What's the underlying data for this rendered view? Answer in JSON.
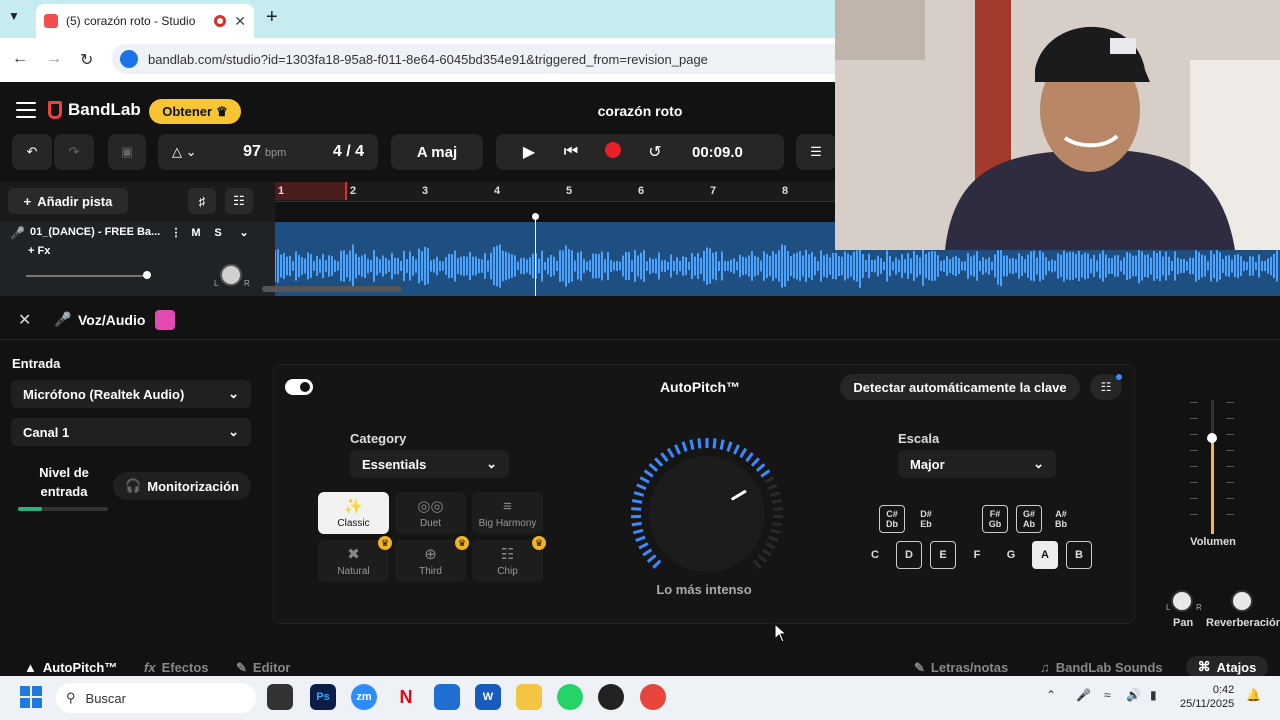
{
  "browser": {
    "tab_title": "(5) corazón roto - Studio",
    "url": "bandlab.com/studio?id=1303fa18-95a8-f011-8e64-6045bd354e91&triggered_from=revision_page"
  },
  "header": {
    "brand": "BandLab",
    "obtener_label": "Obtener",
    "song_title": "corazón roto"
  },
  "toolbar": {
    "bpm": "97",
    "bpm_unit": "bpm",
    "time_signature": "4 / 4",
    "key": "A maj",
    "time": "00:09.0"
  },
  "tracks": {
    "add_track_label": "Añadir pista",
    "name": "01_(DANCE) - FREE Ba...",
    "mute": "M",
    "solo": "S",
    "fx": "+ Fx",
    "pan_l": "L",
    "pan_r": "R",
    "bars": [
      "1",
      "2",
      "3",
      "4",
      "5",
      "6",
      "7",
      "8"
    ]
  },
  "panel": {
    "title": "Voz/Audio",
    "entrada_label": "Entrada",
    "input_device": "Micrófono (Realtek Audio)",
    "channel": "Canal 1",
    "nivel_label": "Nivel de entrada",
    "input_level": 0.27,
    "monitor_label": "Monitorización"
  },
  "autopitch": {
    "title": "AutoPitch™",
    "detect_label": "Detectar automáticamente la clave",
    "category_label": "Category",
    "category_value": "Essentials",
    "presets": [
      {
        "label": "Classic",
        "active": true,
        "premium": false
      },
      {
        "label": "Duet",
        "active": false,
        "premium": false
      },
      {
        "label": "Big Harmony",
        "active": false,
        "premium": false
      },
      {
        "label": "Natural",
        "active": false,
        "premium": true
      },
      {
        "label": "Third",
        "active": false,
        "premium": true
      },
      {
        "label": "Chip",
        "active": false,
        "premium": true
      }
    ],
    "dial_label": "Lo más intenso",
    "dial_level": 0.72,
    "scale_label": "Escala",
    "scale_value": "Major",
    "sharp_keys": [
      {
        "top": "C#",
        "bottom": "Db",
        "outlined": true
      },
      {
        "top": "D#",
        "bottom": "Eb",
        "outlined": false
      },
      {
        "top": "F#",
        "bottom": "Gb",
        "outlined": true
      },
      {
        "top": "G#",
        "bottom": "Ab",
        "outlined": true
      },
      {
        "top": "A#",
        "bottom": "Bb",
        "outlined": false
      }
    ],
    "natural_keys": [
      {
        "label": "C",
        "state": "plain"
      },
      {
        "label": "D",
        "state": "outlined"
      },
      {
        "label": "E",
        "state": "outlined"
      },
      {
        "label": "F",
        "state": "plain"
      },
      {
        "label": "G",
        "state": "plain"
      },
      {
        "label": "A",
        "state": "selected"
      },
      {
        "label": "B",
        "state": "outlined"
      }
    ]
  },
  "mix": {
    "volume_label": "Volumen",
    "volume_level": 0.72,
    "pan_label": "Pan",
    "reverb_label": "Reverberación",
    "l": "L",
    "r": "R"
  },
  "bottom_tabs": {
    "autopitch": "AutoPitch™",
    "efectos": "Efectos",
    "editor": "Editor",
    "letras": "Letras/notas",
    "sounds": "BandLab Sounds",
    "atajos": "Atajos"
  },
  "taskbar": {
    "search_placeholder": "Buscar",
    "time": "0:42",
    "date": "25/11/2025"
  },
  "colors": {
    "accent": "#f5b83d",
    "record": "#e8202a",
    "waveform": "#4aa3ff",
    "lane": "#1e4f80"
  }
}
